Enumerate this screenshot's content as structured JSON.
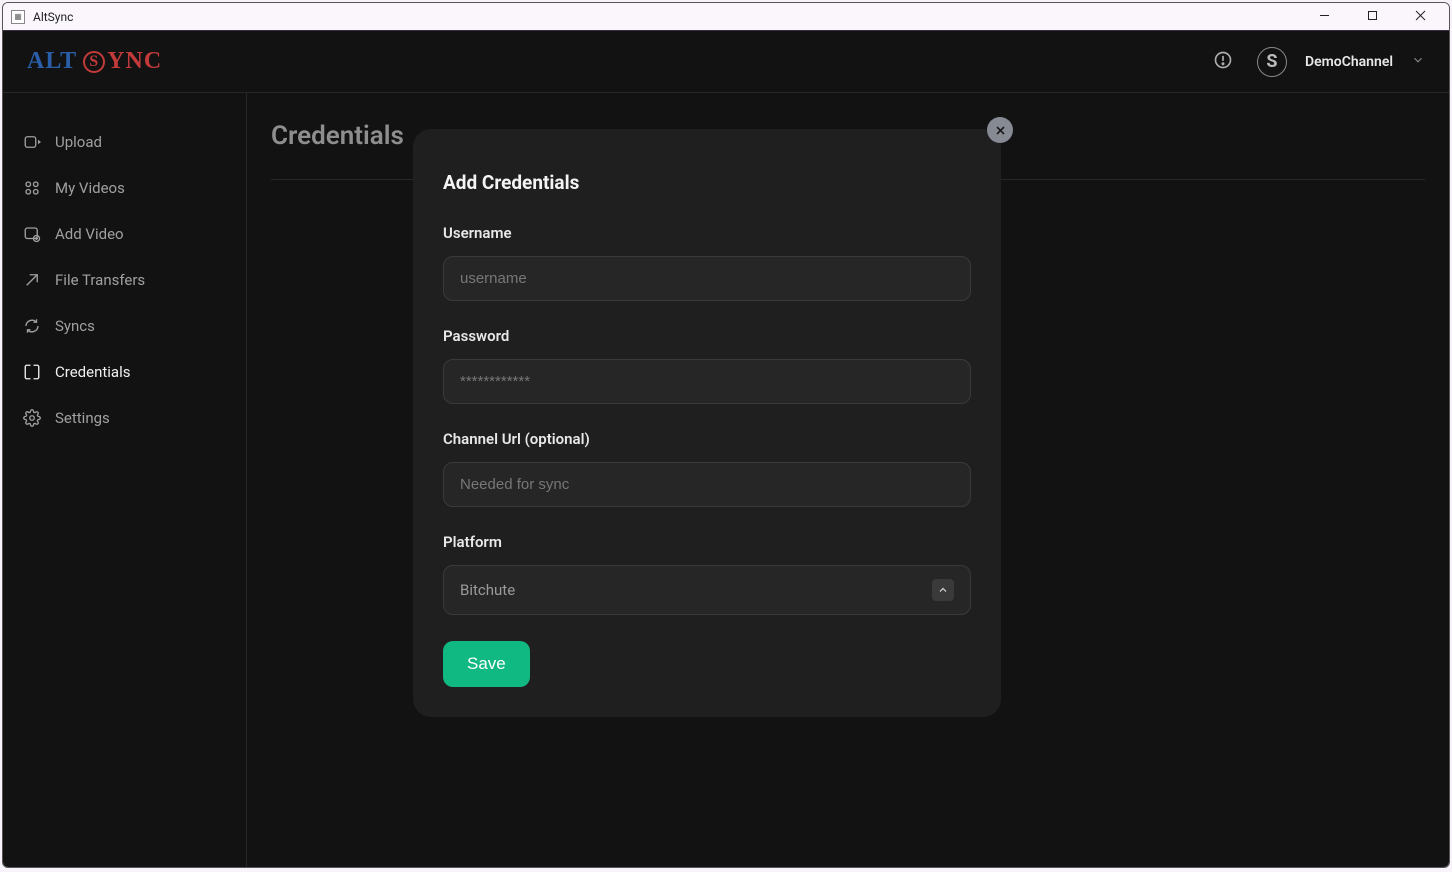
{
  "window": {
    "title": "AltSync"
  },
  "logo": {
    "alt": "ALT",
    "s": "S",
    "ync": "YNC"
  },
  "header": {
    "user_name": "DemoChannel",
    "avatar_letter": "S"
  },
  "sidebar": {
    "items": [
      {
        "label": "Upload"
      },
      {
        "label": "My Videos"
      },
      {
        "label": "Add Video"
      },
      {
        "label": "File Transfers"
      },
      {
        "label": "Syncs"
      },
      {
        "label": "Credentials"
      },
      {
        "label": "Settings"
      }
    ]
  },
  "page": {
    "title": "Credentials"
  },
  "modal": {
    "title": "Add Credentials",
    "fields": {
      "username": {
        "label": "Username",
        "placeholder": "username"
      },
      "password": {
        "label": "Password",
        "placeholder": "************"
      },
      "channel_url": {
        "label": "Channel Url (optional)",
        "placeholder": "Needed for sync"
      },
      "platform": {
        "label": "Platform",
        "value": "Bitchute"
      }
    },
    "save_label": "Save"
  }
}
